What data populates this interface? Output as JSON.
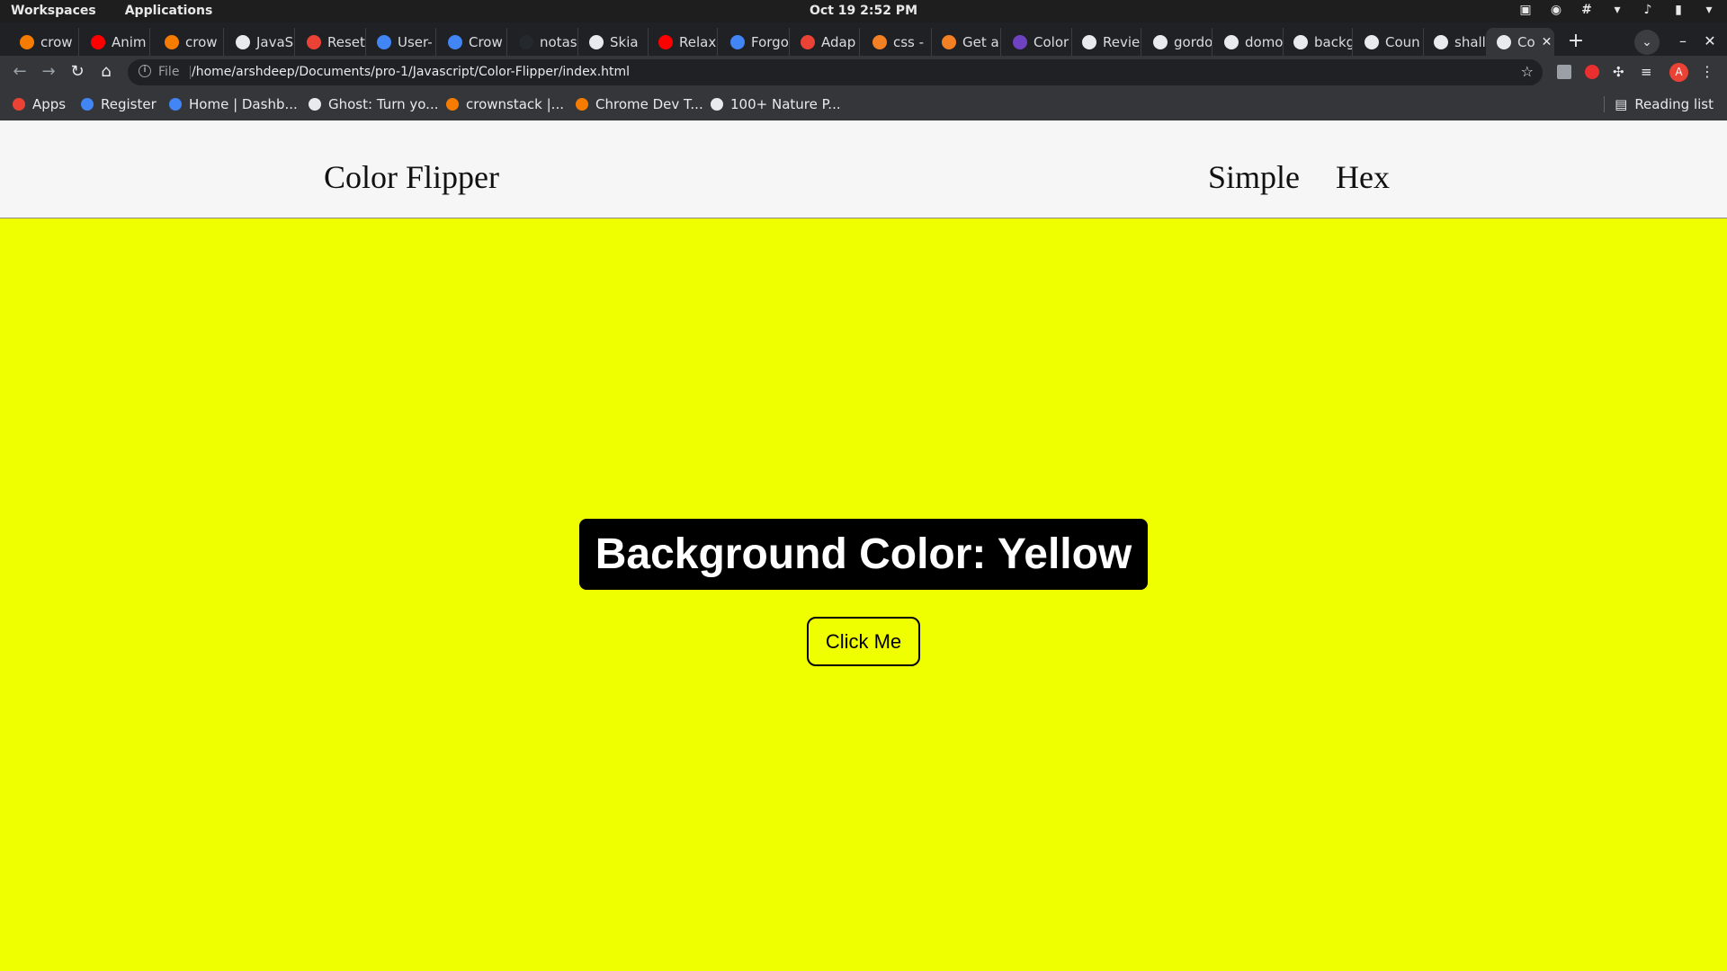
{
  "system_bar": {
    "workspaces": "Workspaces",
    "applications": "Applications",
    "datetime": "Oct 19  2:52 PM"
  },
  "tabs": [
    {
      "label": "crow",
      "icon": "crown-icon",
      "color": "#f57c00"
    },
    {
      "label": "Anim",
      "icon": "youtube-icon",
      "color": "#ff0000"
    },
    {
      "label": "crow",
      "icon": "crown-icon",
      "color": "#f57c00"
    },
    {
      "label": "JavaS",
      "icon": "bookmark-icon",
      "color": "#e8eaed"
    },
    {
      "label": "Reset",
      "icon": "gmail-icon",
      "color": "#ea4335"
    },
    {
      "label": "User-",
      "icon": "k-icon",
      "color": "#4285f4"
    },
    {
      "label": "Crow",
      "icon": "calendar-icon",
      "color": "#4285f4"
    },
    {
      "label": "notas",
      "icon": "github-icon",
      "color": "#24292e"
    },
    {
      "label": "Skia",
      "icon": "globe-icon",
      "color": "#e8eaed"
    },
    {
      "label": "Relax",
      "icon": "youtube-icon",
      "color": "#ff0000"
    },
    {
      "label": "Forgo",
      "icon": "k-icon",
      "color": "#4285f4"
    },
    {
      "label": "Adap",
      "icon": "asterisk-icon",
      "color": "#ea4335"
    },
    {
      "label": "css -",
      "icon": "stackoverflow-icon",
      "color": "#f48024"
    },
    {
      "label": "Get a",
      "icon": "stackoverflow-icon",
      "color": "#f48024"
    },
    {
      "label": "Color",
      "icon": "c-icon",
      "color": "#6f42c1"
    },
    {
      "label": "Revie",
      "icon": "globe-icon",
      "color": "#e8eaed"
    },
    {
      "label": "gordo",
      "icon": "google-icon",
      "color": "#e8eaed"
    },
    {
      "label": "domo",
      "icon": "google-icon",
      "color": "#e8eaed"
    },
    {
      "label": "backg",
      "icon": "google-icon",
      "color": "#e8eaed"
    },
    {
      "label": "Coun",
      "icon": "globe-icon",
      "color": "#e8eaed"
    },
    {
      "label": "shall",
      "icon": "google-icon",
      "color": "#e8eaed"
    },
    {
      "label": "Co",
      "icon": "globe-icon",
      "color": "#e8eaed",
      "active": true
    }
  ],
  "address": {
    "scheme": "File",
    "url": "/home/arshdeep/Documents/pro-1/Javascript/Color-Flipper/index.html"
  },
  "bookmarks": [
    {
      "label": "Apps",
      "icon": "apps-grid-icon",
      "color": "#ea4335"
    },
    {
      "label": "Register",
      "icon": "k-icon",
      "color": "#4285f4"
    },
    {
      "label": "Home | Dashb...",
      "icon": "k-icon",
      "color": "#4285f4"
    },
    {
      "label": "Ghost: Turn yo...",
      "icon": "ghost-icon",
      "color": "#e8eaed"
    },
    {
      "label": "crownstack |...",
      "icon": "crown-icon",
      "color": "#f57c00"
    },
    {
      "label": "Chrome Dev T...",
      "icon": "crown-icon",
      "color": "#f57c00"
    },
    {
      "label": "100+ Nature P...",
      "icon": "unsplash-icon",
      "color": "#e8eaed"
    }
  ],
  "reading_list": "Reading list",
  "profile_initial": "A",
  "page": {
    "brand": "Color Flipper",
    "nav": [
      "Simple",
      "Hex"
    ],
    "color_label": "Background Color: Yellow",
    "button": "Click Me",
    "background": "#f0ff00"
  }
}
